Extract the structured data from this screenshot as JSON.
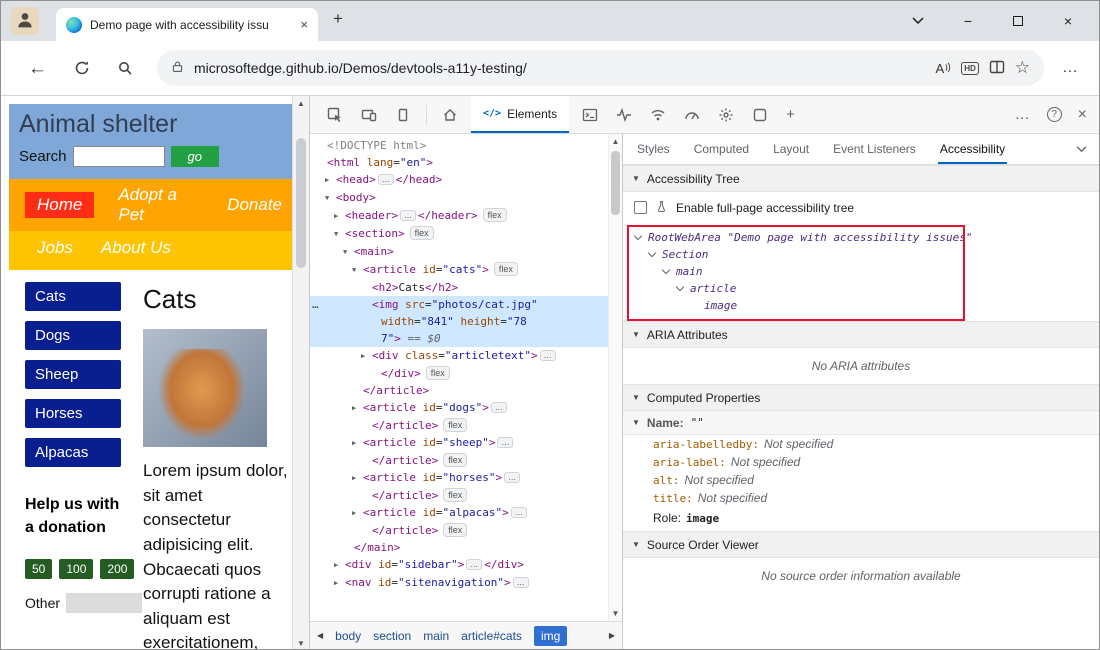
{
  "colors": {
    "accent_blue": "#0067c0",
    "highlight_red": "#e8112d",
    "dom_selection_blue": "#cfe8ff",
    "nav_orange": "#ffa400",
    "nav_yellow": "#ffc400",
    "nav_home_red": "#ff2d16",
    "sidebar_navy": "#0a1f8f",
    "go_green": "#23a043",
    "donation_green": "#245c24",
    "page_header_blue": "#7fa8d9"
  },
  "icons": {
    "back": "←",
    "new_tab": "+",
    "close": "×",
    "minimize": "−",
    "star": "☆",
    "dots": "…",
    "help": "?",
    "add": "+",
    "elements_code": "</>",
    "scroll_up": "▲",
    "scroll_down": "▼",
    "crumb_left": "◀",
    "crumb_right": "▶",
    "section_caret": "▼",
    "tree_expanded": "▼",
    "tree_collapsed": "▶"
  },
  "browser": {
    "tab_title": "Demo page with accessibility issu",
    "url": "microsoftedge.github.io/Demos/devtools-a11y-testing/",
    "hd_badge": "HD",
    "read_aloud_letter": "A"
  },
  "page": {
    "title": "Animal shelter",
    "search_label": "Search",
    "go_button": "go",
    "nav_row1": [
      {
        "label": "Home",
        "accent": true
      },
      {
        "label": "Adopt a Pet",
        "accent": false
      },
      {
        "label": "Donate",
        "accent": false
      }
    ],
    "nav_row2": [
      {
        "label": "Jobs",
        "accent": false
      },
      {
        "label": "About Us",
        "accent": false
      }
    ],
    "sidebar_buttons": [
      "Cats",
      "Dogs",
      "Sheep",
      "Horses",
      "Alpacas"
    ],
    "article_heading": "Cats",
    "article_text": "Lorem ipsum dolor, sit amet consectetur adipisicing elit. Obcaecati quos corrupti ratione a aliquam est exercitationem,",
    "donation": {
      "heading": "Help us with a donation",
      "amounts": [
        "50",
        "100",
        "200"
      ],
      "other_label": "Other"
    }
  },
  "devtools": {
    "elements_tab": "Elements",
    "panel_tabs": [
      "Styles",
      "Computed",
      "Layout",
      "Event Listeners",
      "Accessibility"
    ],
    "active_panel_tab": "Accessibility",
    "breadcrumbs": [
      "body",
      "section",
      "main",
      "article#cats",
      "img"
    ],
    "selected_breadcrumb": "img",
    "dom_rows": [
      {
        "ind": 0,
        "a": "",
        "t": [
          {
            "c": "g",
            "s": "<!DOCTYPE html>"
          }
        ]
      },
      {
        "ind": 0,
        "a": "",
        "t": [
          {
            "c": "t",
            "s": "<html"
          },
          {
            "c": "a",
            "s": " lang"
          },
          {
            "c": "p",
            "s": "="
          },
          {
            "c": "v",
            "s": "\"en\""
          },
          {
            "c": "t",
            "s": ">"
          }
        ]
      },
      {
        "ind": 1,
        "a": ">",
        "t": [
          {
            "c": "t",
            "s": "<head>"
          },
          {
            "c": "pill",
            "s": "…"
          },
          {
            "c": "t",
            "s": "</head>"
          }
        ]
      },
      {
        "ind": 1,
        "a": "v",
        "t": [
          {
            "c": "t",
            "s": "<body>"
          }
        ]
      },
      {
        "ind": 2,
        "a": ">",
        "t": [
          {
            "c": "t",
            "s": "<header>"
          },
          {
            "c": "pill",
            "s": "…"
          },
          {
            "c": "t",
            "s": "</header>"
          },
          {
            "c": "badge",
            "s": "flex"
          }
        ]
      },
      {
        "ind": 2,
        "a": "v",
        "t": [
          {
            "c": "t",
            "s": "<section>"
          },
          {
            "c": "badge",
            "s": "flex"
          }
        ]
      },
      {
        "ind": 3,
        "a": "v",
        "t": [
          {
            "c": "t",
            "s": "<main>"
          }
        ]
      },
      {
        "ind": 4,
        "a": "v",
        "t": [
          {
            "c": "t",
            "s": "<article"
          },
          {
            "c": "a",
            "s": " id"
          },
          {
            "c": "p",
            "s": "="
          },
          {
            "c": "v",
            "s": "\"cats\""
          },
          {
            "c": "t",
            "s": ">"
          },
          {
            "c": "badge",
            "s": "flex"
          }
        ]
      },
      {
        "ind": 5,
        "a": "",
        "t": [
          {
            "c": "t",
            "s": "<h2>"
          },
          {
            "c": "p",
            "s": "Cats"
          },
          {
            "c": "t",
            "s": "</h2>"
          }
        ]
      },
      {
        "ind": 5,
        "a": "",
        "hl": true,
        "gutter": true,
        "t": [
          {
            "c": "t",
            "s": "<img"
          },
          {
            "c": "a",
            "s": " src"
          },
          {
            "c": "p",
            "s": "="
          },
          {
            "c": "v",
            "s": "\"photos/cat.jpg\""
          }
        ]
      },
      {
        "ind": 6,
        "a": "",
        "hl": true,
        "t": [
          {
            "c": "a",
            "s": "width"
          },
          {
            "c": "p",
            "s": "="
          },
          {
            "c": "v",
            "s": "\"841\""
          },
          {
            "c": "a",
            "s": " height"
          },
          {
            "c": "p",
            "s": "="
          },
          {
            "c": "v",
            "s": "\"78"
          }
        ]
      },
      {
        "ind": 6,
        "a": "",
        "hl": true,
        "t": [
          {
            "c": "v",
            "s": "7\""
          },
          {
            "c": "t",
            "s": ">"
          },
          {
            "c": "e",
            "s": " == $0"
          }
        ]
      },
      {
        "ind": 5,
        "a": ">",
        "t": [
          {
            "c": "t",
            "s": "<div"
          },
          {
            "c": "a",
            "s": " class"
          },
          {
            "c": "p",
            "s": "="
          },
          {
            "c": "v",
            "s": "\"articletext\""
          },
          {
            "c": "t",
            "s": ">"
          },
          {
            "c": "pill",
            "s": "…"
          }
        ]
      },
      {
        "ind": 6,
        "a": "",
        "t": [
          {
            "c": "t",
            "s": "</div>"
          },
          {
            "c": "badge",
            "s": "flex"
          }
        ]
      },
      {
        "ind": 4,
        "a": "",
        "t": [
          {
            "c": "t",
            "s": "</article>"
          }
        ]
      },
      {
        "ind": 4,
        "a": ">",
        "t": [
          {
            "c": "t",
            "s": "<article"
          },
          {
            "c": "a",
            "s": " id"
          },
          {
            "c": "p",
            "s": "="
          },
          {
            "c": "v",
            "s": "\"dogs\""
          },
          {
            "c": "t",
            "s": ">"
          },
          {
            "c": "pill",
            "s": "…"
          }
        ]
      },
      {
        "ind": 5,
        "a": "",
        "t": [
          {
            "c": "t",
            "s": "</article>"
          },
          {
            "c": "badge",
            "s": "flex"
          }
        ]
      },
      {
        "ind": 4,
        "a": ">",
        "t": [
          {
            "c": "t",
            "s": "<article"
          },
          {
            "c": "a",
            "s": " id"
          },
          {
            "c": "p",
            "s": "="
          },
          {
            "c": "v",
            "s": "\"sheep\""
          },
          {
            "c": "t",
            "s": ">"
          },
          {
            "c": "pill",
            "s": "…"
          }
        ]
      },
      {
        "ind": 5,
        "a": "",
        "t": [
          {
            "c": "t",
            "s": "</article>"
          },
          {
            "c": "badge",
            "s": "flex"
          }
        ]
      },
      {
        "ind": 4,
        "a": ">",
        "t": [
          {
            "c": "t",
            "s": "<article"
          },
          {
            "c": "a",
            "s": " id"
          },
          {
            "c": "p",
            "s": "="
          },
          {
            "c": "v",
            "s": "\"horses\""
          },
          {
            "c": "t",
            "s": ">"
          },
          {
            "c": "pill",
            "s": "…"
          }
        ]
      },
      {
        "ind": 5,
        "a": "",
        "t": [
          {
            "c": "t",
            "s": "</article>"
          },
          {
            "c": "badge",
            "s": "flex"
          }
        ]
      },
      {
        "ind": 4,
        "a": ">",
        "t": [
          {
            "c": "t",
            "s": "<article"
          },
          {
            "c": "a",
            "s": " id"
          },
          {
            "c": "p",
            "s": "="
          },
          {
            "c": "v",
            "s": "\"alpacas\""
          },
          {
            "c": "t",
            "s": ">"
          },
          {
            "c": "pill",
            "s": "…"
          }
        ]
      },
      {
        "ind": 5,
        "a": "",
        "t": [
          {
            "c": "t",
            "s": "</article>"
          },
          {
            "c": "badge",
            "s": "flex"
          }
        ]
      },
      {
        "ind": 3,
        "a": "",
        "t": [
          {
            "c": "t",
            "s": "</main>"
          }
        ]
      },
      {
        "ind": 2,
        "a": ">",
        "t": [
          {
            "c": "t",
            "s": "<div"
          },
          {
            "c": "a",
            "s": " id"
          },
          {
            "c": "p",
            "s": "="
          },
          {
            "c": "v",
            "s": "\"sidebar\""
          },
          {
            "c": "t",
            "s": ">"
          },
          {
            "c": "pill",
            "s": "…"
          },
          {
            "c": "t",
            "s": "</div>"
          }
        ]
      },
      {
        "ind": 2,
        "a": ">",
        "t": [
          {
            "c": "t",
            "s": "<nav"
          },
          {
            "c": "a",
            "s": " id"
          },
          {
            "c": "p",
            "s": "="
          },
          {
            "c": "v",
            "s": "\"sitenavigation\""
          },
          {
            "c": "t",
            "s": ">"
          },
          {
            "c": "pill",
            "s": "…"
          }
        ]
      }
    ],
    "accessibility": {
      "tree_section": "Accessibility Tree",
      "enable_label": "Enable full-page accessibility tree",
      "tree": [
        {
          "label": "RootWebArea \"Demo page with accessibility issues\"",
          "indent": 0,
          "expandable": true
        },
        {
          "label": "Section",
          "indent": 1,
          "expandable": true
        },
        {
          "label": "main",
          "indent": 2,
          "expandable": true
        },
        {
          "label": "article",
          "indent": 3,
          "expandable": true
        },
        {
          "label": "image",
          "indent": 4,
          "expandable": false
        }
      ],
      "aria_section": "ARIA Attributes",
      "aria_empty": "No ARIA attributes",
      "computed_section": "Computed Properties",
      "name_label": "Name:",
      "name_value": "\"\"",
      "properties": [
        {
          "key": "aria-labelledby:",
          "value": "Not specified"
        },
        {
          "key": "aria-label:",
          "value": "Not specified"
        },
        {
          "key": "alt:",
          "value": "Not specified"
        },
        {
          "key": "title:",
          "value": "Not specified"
        }
      ],
      "role_label": "Role:",
      "role_value": "image",
      "source_section": "Source Order Viewer",
      "source_empty": "No source order information available"
    }
  }
}
